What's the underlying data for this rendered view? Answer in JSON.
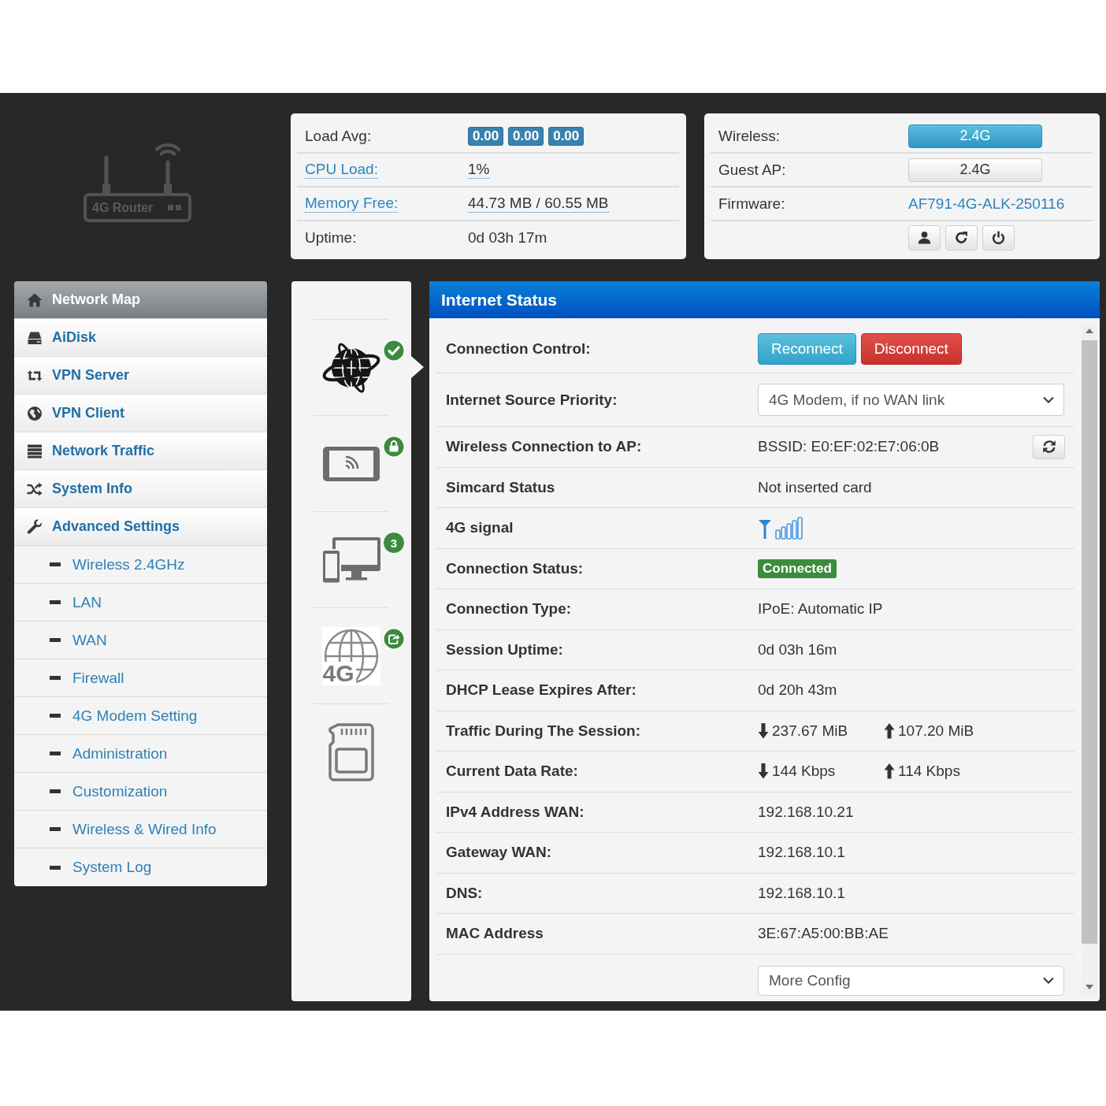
{
  "logo": {
    "text": "4G Router"
  },
  "system_panel": {
    "rows": [
      {
        "kind": "badges",
        "label": "Load Avg:",
        "values": [
          "0.00",
          "0.00",
          "0.00"
        ]
      },
      {
        "kind": "link",
        "label": "CPU Load:",
        "value": "1%"
      },
      {
        "kind": "link",
        "label": "Memory Free:",
        "value": "44.73 MB / 60.55 MB"
      },
      {
        "kind": "text",
        "label": "Uptime:",
        "value": "0d 03h 17m"
      }
    ]
  },
  "wireless_panel": {
    "rows": [
      {
        "kind": "toggle",
        "label": "Wireless:",
        "value": "2.4G",
        "on": true
      },
      {
        "kind": "toggle",
        "label": "Guest AP:",
        "value": "2.4G",
        "on": false
      },
      {
        "kind": "value_link",
        "label": "Firmware:",
        "value": "AF791-4G-ALK-250116"
      }
    ]
  },
  "sidebar": {
    "items": [
      {
        "label": "Network Map",
        "selected": true
      },
      {
        "label": "AiDisk",
        "selected": false
      },
      {
        "label": "VPN Server",
        "selected": false
      },
      {
        "label": "VPN Client",
        "selected": false
      },
      {
        "label": "Network Traffic",
        "selected": false
      },
      {
        "label": "System Info",
        "selected": false
      },
      {
        "label": "Advanced Settings",
        "selected": false,
        "children": [
          {
            "label": "Wireless 2.4GHz",
            "selected": false
          },
          {
            "label": "LAN",
            "selected": false
          },
          {
            "label": "WAN",
            "selected": false
          },
          {
            "label": "Firewall",
            "selected": false
          },
          {
            "label": "4G Modem Setting",
            "selected": false
          },
          {
            "label": "Administration",
            "selected": false
          },
          {
            "label": "Customization",
            "selected": false
          },
          {
            "label": "Wireless & Wired Info",
            "selected": false
          },
          {
            "label": "System Log",
            "selected": false
          }
        ]
      }
    ]
  },
  "map_nodes": [
    {
      "selected": true
    },
    {
      "selected": false
    },
    {
      "selected": false,
      "count": "3"
    },
    {
      "selected": false,
      "label": "4G"
    },
    {
      "selected": false
    }
  ],
  "internet_status": {
    "title": "Internet Status",
    "rows": [
      {
        "kind": "buttons",
        "label": "Connection Control:",
        "buttons": [
          {
            "label": "Reconnect",
            "kind": "info"
          },
          {
            "label": "Disconnect",
            "kind": "danger"
          }
        ]
      },
      {
        "kind": "select",
        "label": "Internet Source Priority:",
        "value": "4G Modem, if no WAN link"
      },
      {
        "kind": "refresh",
        "label": "Wireless Connection to AP:",
        "value": "BSSID: E0:EF:02:E7:06:0B"
      },
      {
        "kind": "text",
        "label": "Simcard Status",
        "value": "Not inserted card"
      },
      {
        "kind": "signal",
        "label": "4G signal"
      },
      {
        "kind": "badge",
        "label": "Connection Status:",
        "value": "Connected"
      },
      {
        "kind": "text",
        "label": "Connection Type:",
        "value": "IPoE: Automatic IP"
      },
      {
        "kind": "text",
        "label": "Session Uptime:",
        "value": "0d 03h 16m"
      },
      {
        "kind": "text",
        "label": "DHCP Lease Expires After:",
        "value": "0d 20h 43m"
      },
      {
        "kind": "traffic",
        "label": "Traffic During The Session:",
        "down": "237.67 MiB",
        "up": "107.20 MiB"
      },
      {
        "kind": "traffic",
        "label": "Current Data Rate:",
        "down": "144 Kbps",
        "up": "114 Kbps"
      },
      {
        "kind": "text",
        "label": "IPv4 Address WAN:",
        "value": "192.168.10.21"
      },
      {
        "kind": "text",
        "label": "Gateway WAN:",
        "value": "192.168.10.1"
      },
      {
        "kind": "text",
        "label": "DNS:",
        "value": "192.168.10.1"
      },
      {
        "kind": "text",
        "label": "MAC Address",
        "value": "3E:67:A5:00:BB:AE"
      },
      {
        "kind": "select",
        "value": "More Config"
      }
    ]
  }
}
